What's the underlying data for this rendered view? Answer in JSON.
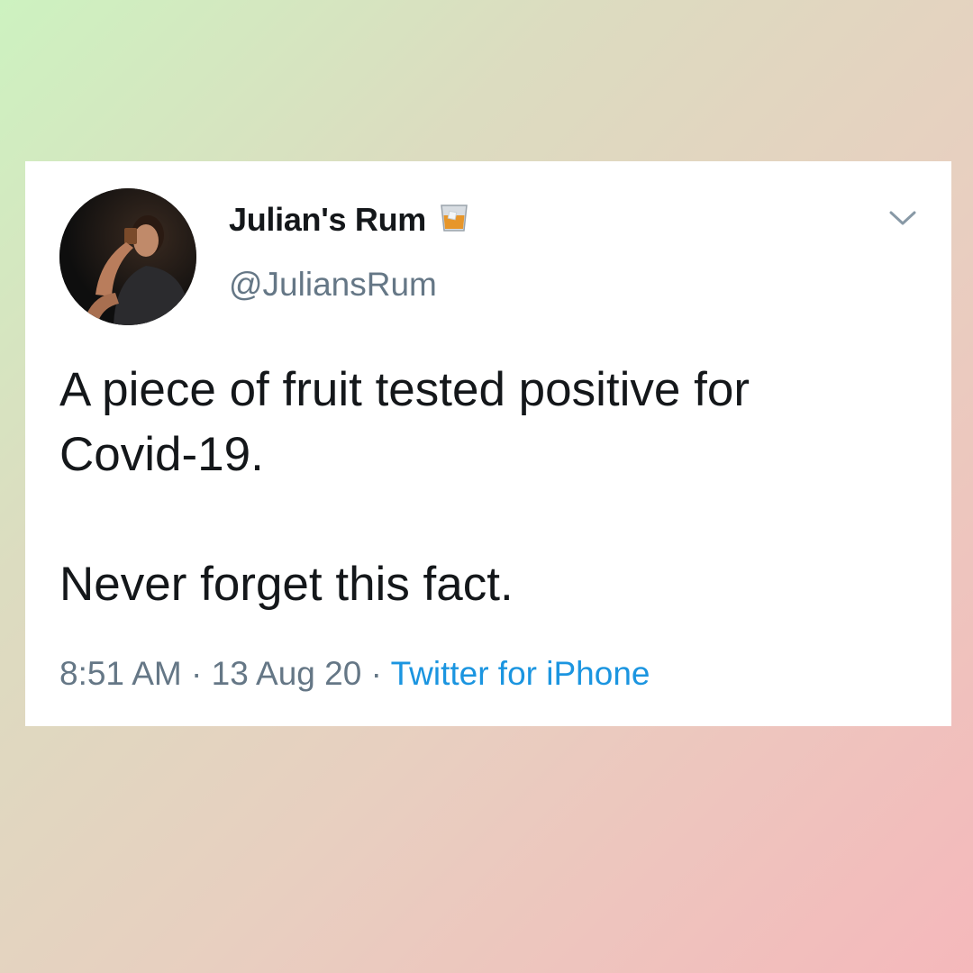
{
  "tweet": {
    "display_name": "Julian's Rum",
    "name_emoji_icon": "tumbler-glass-icon",
    "handle": "@JuliansRum",
    "text_lines": [
      "A piece of fruit tested positive for",
      "Covid-19.",
      "",
      "Never forget this fact."
    ],
    "time": "8:51 AM",
    "separator": "·",
    "date": "13 Aug 20",
    "source": "Twitter for iPhone",
    "menu_icon": "chevron-down-icon",
    "avatar_icon": "profile-photo"
  },
  "colors": {
    "text_primary": "#14171a",
    "text_secondary": "#657786",
    "link": "#1b95e0",
    "card_bg": "#ffffff"
  }
}
